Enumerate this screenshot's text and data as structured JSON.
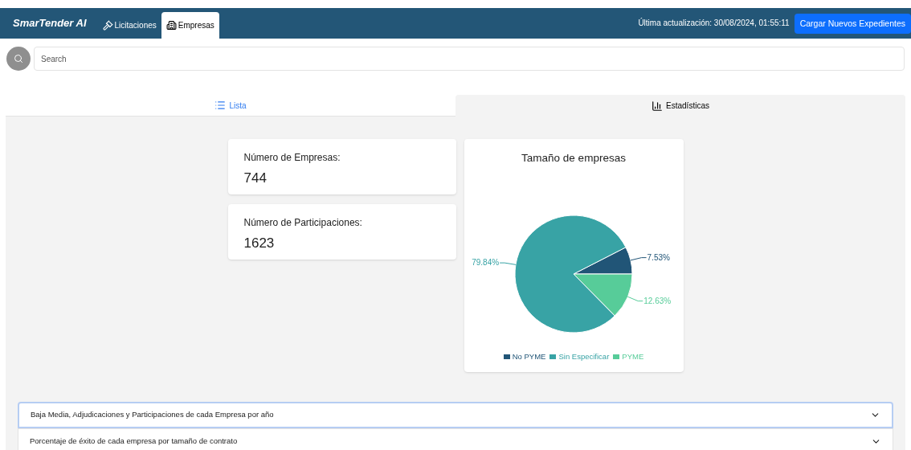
{
  "navbar": {
    "brand": "SmarTender AI",
    "tabs": [
      {
        "label": "Licitaciones",
        "kind": "gavel",
        "selected": false
      },
      {
        "label": "Empresas",
        "kind": "building",
        "selected": true
      }
    ],
    "last_update": "Última actualización: 30/08/2024, 01:55:11",
    "action_button": "Cargar Nuevos Expedientes"
  },
  "search": {
    "placeholder": "Search"
  },
  "view_tabs": [
    {
      "label": "Lista",
      "kind": "list",
      "selected": false
    },
    {
      "label": "Estadísticas",
      "kind": "chart",
      "selected": true
    }
  ],
  "stat_cards": [
    {
      "label": "Número de Empresas:",
      "value": "744"
    },
    {
      "label": "Número de Participaciones:",
      "value": "1623"
    }
  ],
  "pie_card": {
    "chart_data": {
      "type": "pie",
      "title": "Tamaño de empresas",
      "categories": [
        "No PYME",
        "Sin Especificar",
        "PYME"
      ],
      "values": [
        7.53,
        79.84,
        12.63
      ],
      "colors": [
        "#215577",
        "#38a3a5",
        "#57cc99"
      ],
      "value_labels": [
        "7.53%",
        "79.84%",
        "12.63%"
      ]
    }
  },
  "accordions": [
    {
      "title": "Baja Media, Adjudicaciones y Participaciones de cada Empresa por año",
      "expanded": false,
      "focused": true
    },
    {
      "title": "Porcentaje de éxito de cada empresa por tamaño de contrato",
      "expanded": false,
      "focused": false
    }
  ]
}
